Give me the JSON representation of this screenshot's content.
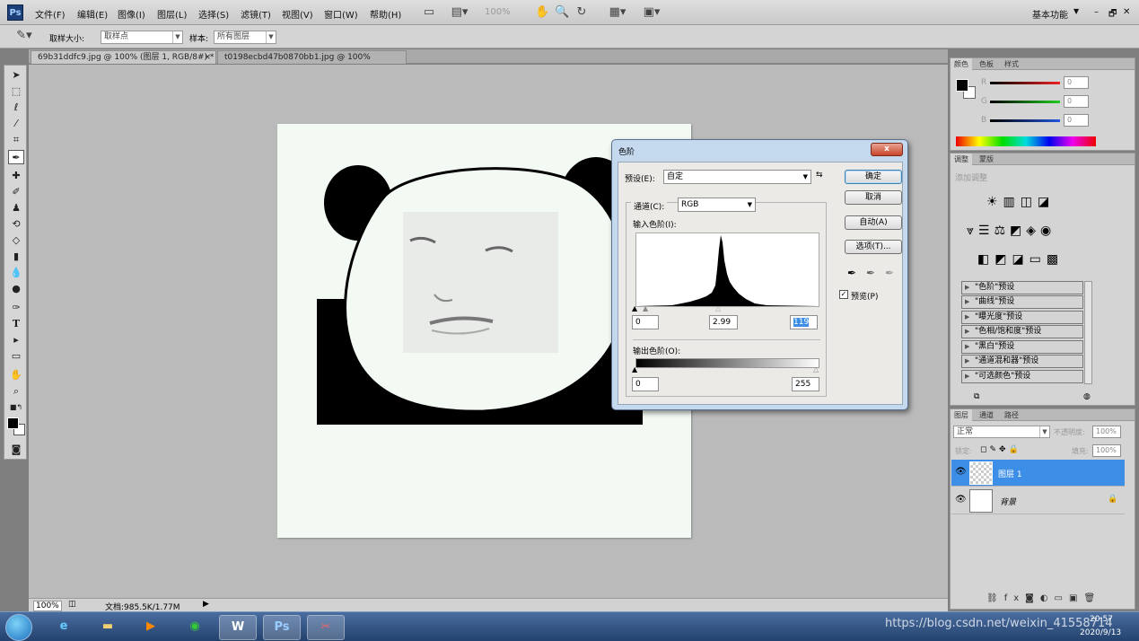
{
  "app": {
    "logo": "Ps"
  },
  "menus": [
    "文件(F)",
    "编辑(E)",
    "图像(I)",
    "图层(L)",
    "选择(S)",
    "滤镜(T)",
    "视图(V)",
    "窗口(W)",
    "帮助(H)"
  ],
  "menubar": {
    "zoom": "100%",
    "workspace": "基本功能",
    "win_controls": [
      "–",
      "🗗",
      "✕"
    ]
  },
  "options": {
    "sample_size_label": "取样大小:",
    "sample_size_value": "取样点",
    "sample_label": "样本:",
    "sample_value": "所有图层"
  },
  "tabs": [
    {
      "label": "69b31ddfc9.jpg @ 100% (图层 1, RGB/8#) *",
      "close": "×"
    },
    {
      "label": "t0198ecbd47b0870bb1.jpg @ 100%(RGB/8#) *",
      "close": "×"
    }
  ],
  "status": {
    "zoom": "100%",
    "doc_info": "文档:985.5K/1.77M"
  },
  "color_panel": {
    "tabs": [
      "颜色",
      "色板",
      "样式"
    ],
    "channels": [
      {
        "name": "R",
        "value": "0",
        "color": "#d02020"
      },
      {
        "name": "G",
        "value": "0",
        "color": "#20a020"
      },
      {
        "name": "B",
        "value": "0",
        "color": "#2050c8"
      }
    ]
  },
  "adjust_panel": {
    "tabs": [
      "调整",
      "蒙版"
    ],
    "title": "添加调整",
    "presets": [
      "\"色阶\"预设",
      "\"曲线\"预设",
      "\"曝光度\"预设",
      "\"色相/饱和度\"预设",
      "\"黑白\"预设",
      "\"通道混和器\"预设",
      "\"可选颜色\"预设"
    ]
  },
  "layers_panel": {
    "tabs": [
      "图层",
      "通道",
      "路径"
    ],
    "blend_mode": "正常",
    "opacity_label": "不透明度:",
    "opacity": "100%",
    "lock_label": "锁定:",
    "fill_label": "填充:",
    "fill": "100%",
    "layers": [
      {
        "name": "图层 1",
        "selected": true
      },
      {
        "name": "背景",
        "selected": false
      }
    ]
  },
  "dialog": {
    "title": "色阶",
    "close": "x",
    "preset_label": "预设(E):",
    "preset_value": "自定",
    "channel_label": "通道(C):",
    "channel_value": "RGB",
    "input_label": "输入色阶(I):",
    "input_black": "0",
    "input_gamma": "2.99",
    "input_white": "119",
    "output_label": "输出色阶(O):",
    "output_black": "0",
    "output_white": "255",
    "buttons": {
      "ok": "确定",
      "cancel": "取消",
      "auto": "自动(A)",
      "options": "选项(T)..."
    },
    "preview_label": "预览(P)",
    "preview_checked": true
  },
  "taskbar": {
    "watermark": "https://blog.csdn.net/weixin_41558714",
    "time": "20:57",
    "date": "2020/9/13"
  }
}
